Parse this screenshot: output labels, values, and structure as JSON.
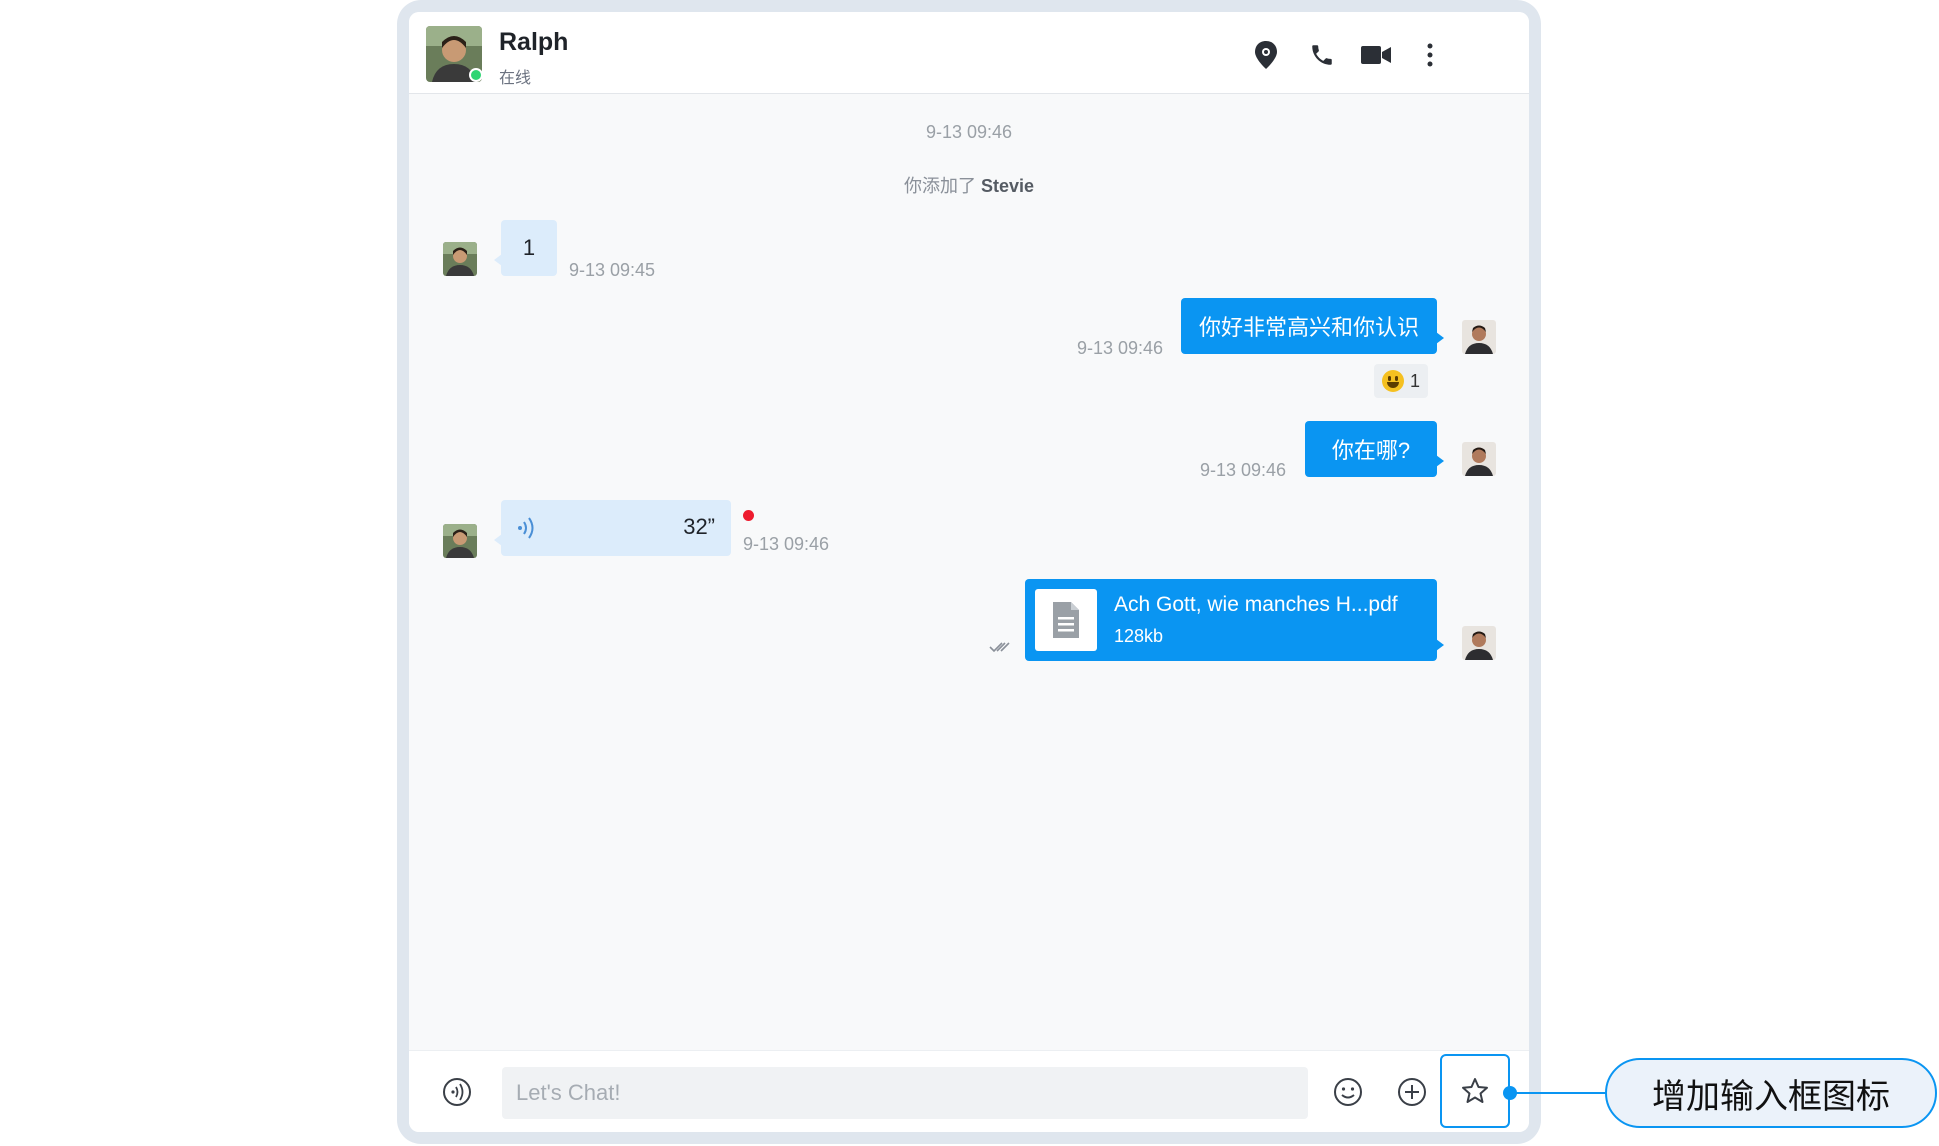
{
  "header": {
    "name": "Ralph",
    "status": "在线"
  },
  "timeline": {
    "time": "9-13 09:46",
    "system_prefix": "你添加了",
    "system_name": "Stevie"
  },
  "messages": [
    {
      "direction": "in",
      "text": "1",
      "time": "9-13 09:45"
    },
    {
      "direction": "out",
      "text": "你好非常高兴和你认识",
      "time": "9-13 09:46",
      "reaction": {
        "emoji": "grinning-face",
        "count": "1"
      }
    },
    {
      "direction": "out",
      "text": "你在哪?",
      "time": "9-13 09:46"
    },
    {
      "direction": "in",
      "type": "voice",
      "duration": "32”",
      "time": "9-13 09:46",
      "unread": true
    },
    {
      "direction": "out",
      "type": "file",
      "filename": "Ach Gott, wie manches H...pdf",
      "size": "128kb",
      "read": true
    }
  ],
  "composer": {
    "placeholder": "Let's Chat!",
    "value": ""
  },
  "annotation": {
    "label": "增加输入框图标"
  },
  "colors": {
    "accent": "#0a95f2",
    "bubble_in": "#dcecfb",
    "online": "#2ed573",
    "unread": "#ee1b2e"
  }
}
